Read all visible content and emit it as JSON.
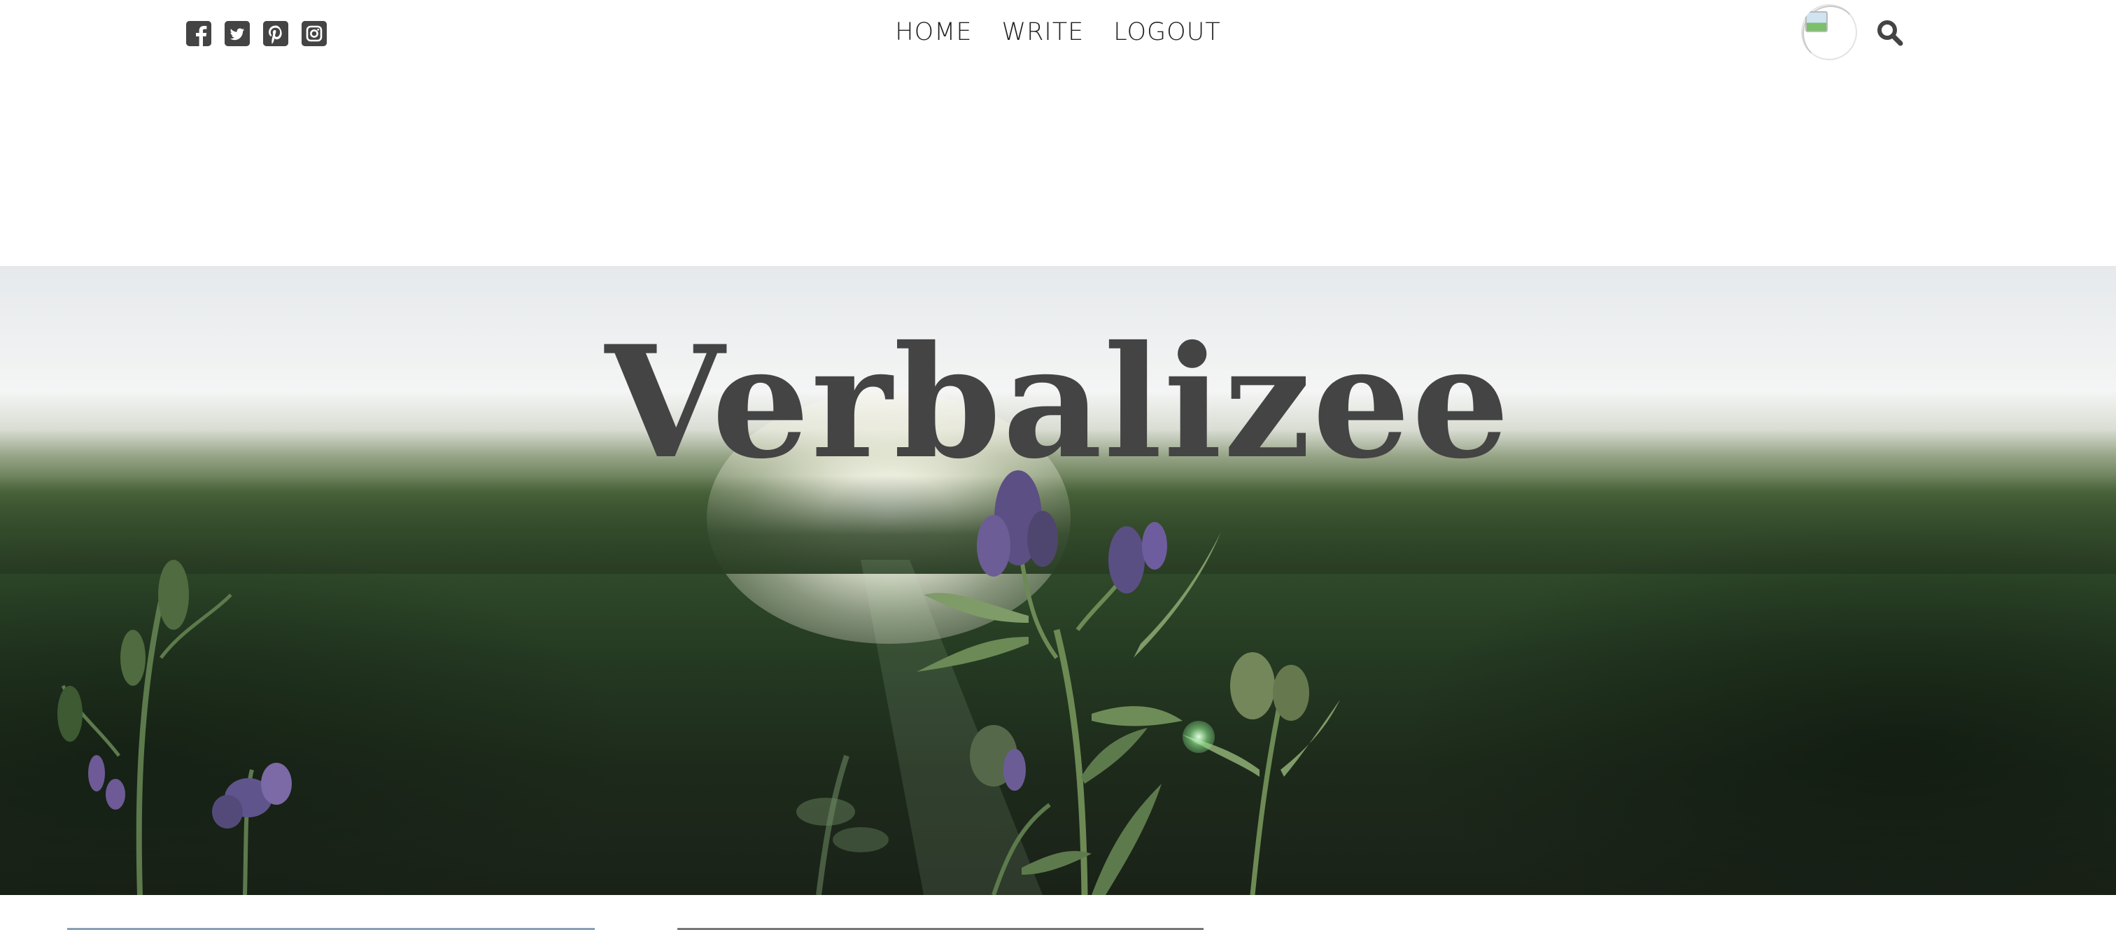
{
  "social": {
    "icons": [
      "facebook-square-icon",
      "twitter-square-icon",
      "pinterest-square-icon",
      "instagram-square-icon"
    ]
  },
  "nav": {
    "items": [
      {
        "label": "HOME"
      },
      {
        "label": "WRITE"
      },
      {
        "label": "LOGOUT"
      }
    ]
  },
  "user": {
    "avatar_icon": "profile-image-icon"
  },
  "search": {
    "icon": "search-icon"
  },
  "header": {
    "title": "Verbalizee"
  },
  "colors": {
    "text": "#444444",
    "nav_text": "#222222",
    "background": "#ffffff"
  }
}
